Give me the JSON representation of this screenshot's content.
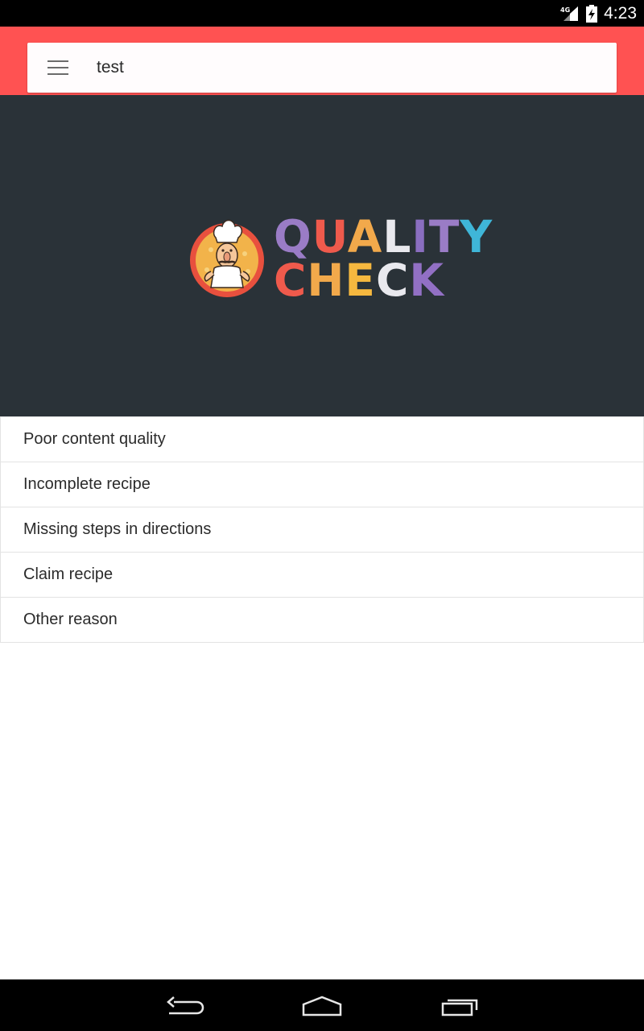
{
  "status_bar": {
    "network": "4G",
    "time": "4:23"
  },
  "search": {
    "value": "test"
  },
  "brand": {
    "line1": [
      "Q",
      "U",
      "A",
      "L",
      "I",
      "T",
      "Y"
    ],
    "line2": [
      "C",
      "H",
      "E",
      "C",
      "K"
    ],
    "line1_colors": [
      "#9a7cc6",
      "#ef5a4c",
      "#f2a94b",
      "#e9e9ee",
      "#8a6ec0",
      "#9a7cc6",
      "#3fb6d8"
    ],
    "line2_colors": [
      "#ef5a4c",
      "#f2a94b",
      "#f6b83f",
      "#e9e9ee",
      "#9270c4"
    ]
  },
  "reasons": [
    {
      "label": "Poor content quality"
    },
    {
      "label": "Incomplete recipe"
    },
    {
      "label": "Missing steps in directions"
    },
    {
      "label": "Claim recipe"
    },
    {
      "label": "Other reason"
    }
  ],
  "colors": {
    "app_bar": "#ff5252",
    "hero_bg": "#2a3238",
    "logo_ring": "#e8503e",
    "logo_fill": "#f2b34a"
  },
  "icons": {
    "menu": "menu-icon",
    "back": "back-icon",
    "home": "home-icon",
    "recents": "recents-icon",
    "signal": "signal-icon",
    "battery": "battery-icon",
    "logo": "chef-logo-icon"
  }
}
